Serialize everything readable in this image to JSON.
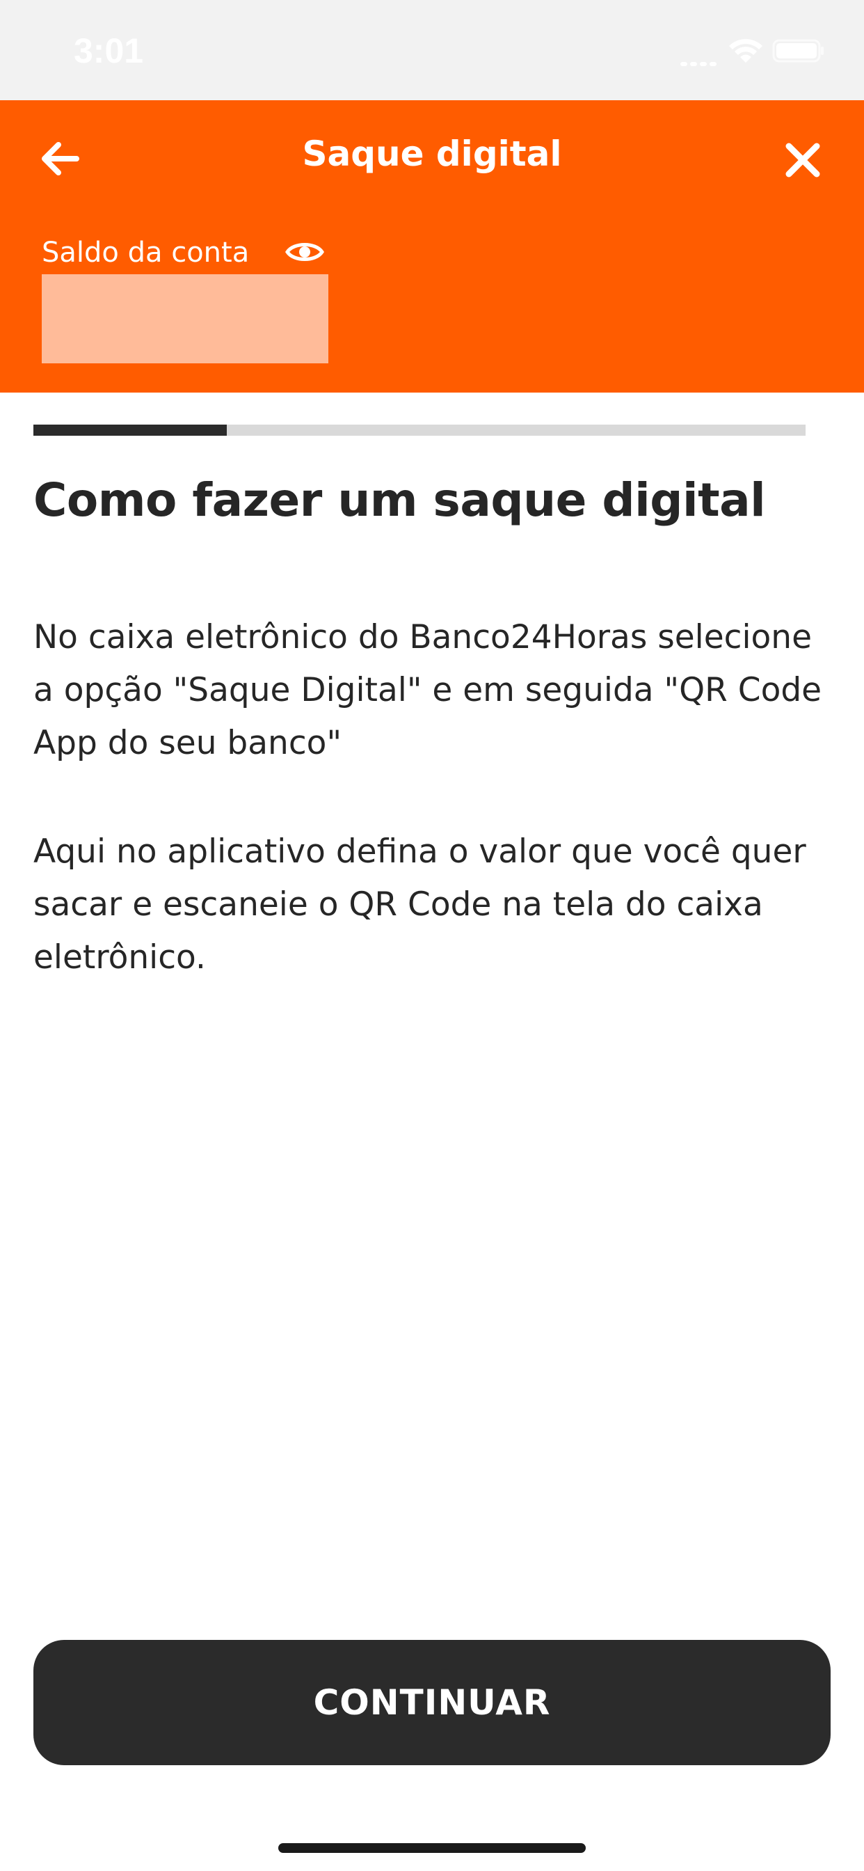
{
  "status_bar": {
    "time": "3:01"
  },
  "header": {
    "title": "Saque digital",
    "balance_label": "Saldo da conta",
    "back_icon": "arrow-left-icon",
    "close_icon": "close-icon",
    "eye_icon": "eye-icon"
  },
  "progress": {
    "fraction": 0.25
  },
  "content": {
    "title": "Como fazer um saque digital",
    "paragraph_1": "No caixa eletrônico do Banco24Horas selecione a opção \"Saque Digital\" e em seguida \"QR Code App do seu banco\"",
    "paragraph_2": "Aqui no aplicativo defina o valor que você quer sacar e escaneie o QR Code na tela do caixa eletrônico."
  },
  "footer": {
    "continue_label": "CONTINUAR"
  },
  "colors": {
    "brand_orange": "#ff5c00",
    "dark": "#2b2b2b",
    "balance_mask": "#ffbb99"
  }
}
